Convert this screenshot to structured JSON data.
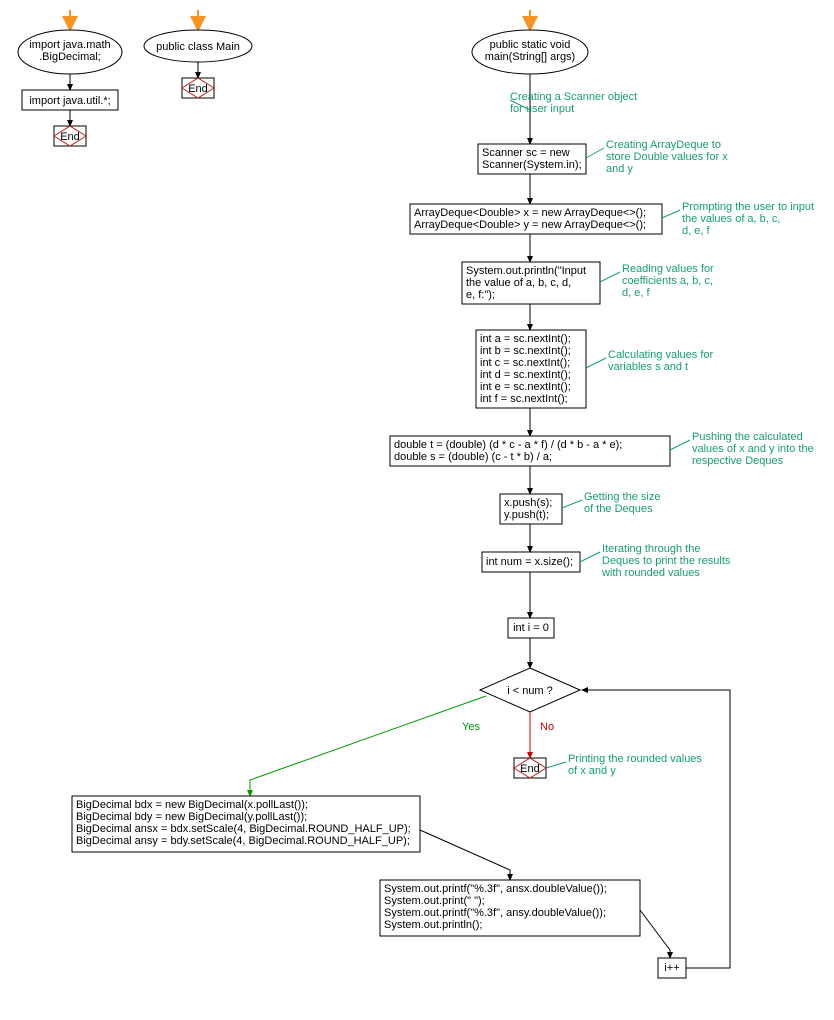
{
  "col1": {
    "ellipse1_l1": "import java.math",
    "ellipse1_l2": ".BigDecimal;",
    "box1": "import java.util.*;",
    "end": "End"
  },
  "col2": {
    "ellipse1": "public class Main",
    "end": "End"
  },
  "main": {
    "ellipse_l1": "public static void",
    "ellipse_l2": "main(String[] args)",
    "anno1_l1": "Creating a Scanner object",
    "anno1_l2": "for user input",
    "box1_l1": "Scanner sc = new",
    "box1_l2": "Scanner(System.in);",
    "anno2_l1": "Creating ArrayDeque to",
    "anno2_l2": "store Double values for x",
    "anno2_l3": "and y",
    "box2_l1": "ArrayDeque<Double> x = new ArrayDeque<>();",
    "box2_l2": "ArrayDeque<Double> y = new ArrayDeque<>();",
    "anno3_l1": "Prompting the user to input",
    "anno3_l2": "the values of a, b, c,",
    "anno3_l3": "d, e, f",
    "box3_l1": "System.out.println(\"Input",
    "box3_l2": "the value of a, b, c, d,",
    "box3_l3": "e, f:\");",
    "anno4_l1": "Reading values for",
    "anno4_l2": "coefficients a, b, c,",
    "anno4_l3": "d, e, f",
    "box4_l1": "int a = sc.nextInt();",
    "box4_l2": "int b = sc.nextInt();",
    "box4_l3": "int c = sc.nextInt();",
    "box4_l4": "int d = sc.nextInt();",
    "box4_l5": "int e = sc.nextInt();",
    "box4_l6": "int f = sc.nextInt();",
    "anno5_l1": "Calculating values for",
    "anno5_l2": "variables s and t",
    "box5_l1": "double t = (double) (d * c - a * f) / (d * b - a * e);",
    "box5_l2": "double s = (double) (c - t * b) / a;",
    "anno6_l1": "Pushing the calculated",
    "anno6_l2": "values of x and y into the",
    "anno6_l3": "respective Deques",
    "box6_l1": "x.push(s);",
    "box6_l2": "y.push(t);",
    "anno7_l1": "Getting the size",
    "anno7_l2": "of the Deques",
    "box7": "int num = x.size();",
    "anno8_l1": "Iterating through the",
    "anno8_l2": "Deques to print the results",
    "anno8_l3": "with rounded values",
    "box8": "int i = 0",
    "decision": "i < num ?",
    "yes": "Yes",
    "no": "No",
    "end": "End",
    "anno9_l1": "Printing the rounded values",
    "anno9_l2": "of x and y",
    "box9_l1": "BigDecimal bdx = new BigDecimal(x.pollLast());",
    "box9_l2": "BigDecimal bdy = new BigDecimal(y.pollLast());",
    "box9_l3": "BigDecimal ansx = bdx.setScale(4, BigDecimal.ROUND_HALF_UP);",
    "box9_l4": "BigDecimal ansy = bdy.setScale(4, BigDecimal.ROUND_HALF_UP);",
    "box10_l1": "System.out.printf(\"%.3f\", ansx.doubleValue());",
    "box10_l2": "System.out.print(\" \");",
    "box10_l3": "System.out.printf(\"%.3f\", ansy.doubleValue());",
    "box10_l4": "System.out.println();",
    "box11": "i++"
  }
}
